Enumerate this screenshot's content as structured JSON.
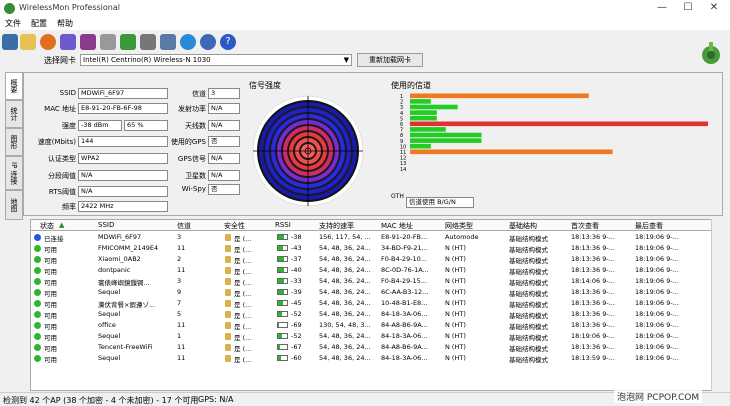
{
  "window": {
    "title": "WirelessMon Professional"
  },
  "menu": [
    "文件",
    "配置",
    "帮助"
  ],
  "adapter": {
    "label": "选择网卡",
    "value": "Intel(R) Centrino(R) Wireless-N 1030",
    "reload_label": "重新加载网卡"
  },
  "side_tabs": [
    "概要",
    "统计",
    "图形",
    "IP 连接",
    "地图"
  ],
  "info": {
    "ssid_label": "SSID",
    "ssid": "MDWiFi_6F97",
    "mac_label": "MAC 地址",
    "mac": "E8-91-20-FB-6F-98",
    "strength_label": "强度",
    "strength_dbm": "-38 dBm",
    "strength_pct": "65 %",
    "speed_label": "速度(Mbits)",
    "speed": "144",
    "auth_label": "认证类型",
    "auth": "WPA2",
    "frag_label": "分段阈值",
    "frag": "N/A",
    "rts_label": "RTS阈值",
    "rts": "N/A",
    "freq_label": "频率",
    "freq": "2422 MHz",
    "channel_label": "信道",
    "channel": "3",
    "txpower_label": "发射功率",
    "txpower": "N/A",
    "antenna_label": "天线数",
    "antenna": "N/A",
    "gps_used_label": "使用的GPS",
    "gps_used": "否",
    "gps_signal_label": "GPS信号",
    "gps_signal": "N/A",
    "satellites_label": "卫星数",
    "satellites": "N/A",
    "wispy_label": "Wi-Spy",
    "wispy": "否"
  },
  "signal": {
    "title": "信号强度"
  },
  "channels": {
    "title": "使用的信道",
    "labels": [
      "1",
      "2",
      "3",
      "4",
      "5",
      "6",
      "7",
      "8",
      "9",
      "10",
      "11",
      "12",
      "13",
      "14"
    ],
    "other_label": "OTH",
    "bars": [
      {
        "channel": "1",
        "level": 0.6,
        "color": "#f07820"
      },
      {
        "channel": "2",
        "level": 0.07,
        "color": "#22cc22"
      },
      {
        "channel": "3",
        "level": 0.16,
        "color": "#22cc22"
      },
      {
        "channel": "4",
        "level": 0.09,
        "color": "#22cc22"
      },
      {
        "channel": "5",
        "level": 0.09,
        "color": "#22cc22"
      },
      {
        "channel": "6",
        "level": 1.0,
        "color": "#e03030"
      },
      {
        "channel": "7",
        "level": 0.12,
        "color": "#22cc22"
      },
      {
        "channel": "8",
        "level": 0.24,
        "color": "#22cc22"
      },
      {
        "channel": "9",
        "level": 0.24,
        "color": "#22cc22"
      },
      {
        "channel": "10",
        "level": 0.07,
        "color": "#22cc22"
      },
      {
        "channel": "11",
        "level": 0.68,
        "color": "#f07820"
      }
    ],
    "select_value": "信道使用 B/G/N"
  },
  "table": {
    "headers": [
      "状态",
      "SSID",
      "信道",
      "安全性",
      "RSSI",
      "支持的速率",
      "MAC 地址",
      "网络类型",
      "基础结构",
      "首次查看",
      "最后查看"
    ],
    "rows": [
      {
        "status": "已连接",
        "status_color": "#2255dd",
        "ssid": "MDWiFi_6F97",
        "channel": "3",
        "security": "是 (...",
        "rssi": "-38",
        "rssi_level": 0.65,
        "rates": "156, 117, 54, ...",
        "mac": "E8-91-20-FB...",
        "nettype": "Automode",
        "infra": "基础结构模式",
        "first": "18:13:36 9-...",
        "last": "18:19:06 9-..."
      },
      {
        "status": "可用",
        "status_color": "#2db52d",
        "ssid": "FMICOMM_2149E4",
        "channel": "11",
        "security": "是 (...",
        "rssi": "-43",
        "rssi_level": 0.57,
        "rates": "54, 48, 36, 24...",
        "mac": "34-BD-F9-21...",
        "nettype": "N (HT)",
        "infra": "基础结构模式",
        "first": "18:13:36 9-...",
        "last": "18:19:06 9-..."
      },
      {
        "status": "可用",
        "status_color": "#2db52d",
        "ssid": "Xiaomi_0AB2",
        "channel": "2",
        "security": "是 (...",
        "rssi": "-37",
        "rssi_level": 0.67,
        "rates": "54, 48, 36, 24...",
        "mac": "F0-B4-29-10...",
        "nettype": "N (HT)",
        "infra": "基础结构模式",
        "first": "18:13:36 9-...",
        "last": "18:19:06 9-..."
      },
      {
        "status": "可用",
        "status_color": "#2db52d",
        "ssid": "dontpanic",
        "channel": "11",
        "security": "是 (...",
        "rssi": "-40",
        "rssi_level": 0.62,
        "rates": "54, 48, 36, 24...",
        "mac": "8C-0D-76-1A...",
        "nettype": "N (HT)",
        "infra": "基础结构模式",
        "first": "18:13:36 9-...",
        "last": "18:19:06 9-..."
      },
      {
        "status": "可用",
        "status_color": "#2db52d",
        "ssid": "寰俵峰嶼鏡鏁锕...",
        "channel": "3",
        "security": "是 (...",
        "rssi": "-33",
        "rssi_level": 0.72,
        "rates": "54, 48, 36, 24...",
        "mac": "F0-B4-29-15...",
        "nettype": "N (HT)",
        "infra": "基础结构模式",
        "first": "18:14:06 9-...",
        "last": "18:19:06 9-..."
      },
      {
        "status": "可用",
        "status_color": "#2db52d",
        "ssid": "Sequel",
        "channel": "9",
        "security": "是 (...",
        "rssi": "-39",
        "rssi_level": 0.63,
        "rates": "54, 48, 36, 24...",
        "mac": "6C-AA-B3-12...",
        "nettype": "N (HT)",
        "infra": "基础结构模式",
        "first": "18:13:36 9-...",
        "last": "18:19:06 9-..."
      },
      {
        "status": "可用",
        "status_color": "#2db52d",
        "ssid": "瀵伏背餐×鍜遵ゾ...",
        "channel": "7",
        "security": "是 (...",
        "rssi": "-45",
        "rssi_level": 0.53,
        "rates": "54, 48, 36, 24...",
        "mac": "10-48-B1-E8...",
        "nettype": "N (HT)",
        "infra": "基础结构模式",
        "first": "18:13:36 9-...",
        "last": "18:19:06 9-..."
      },
      {
        "status": "可用",
        "status_color": "#2db52d",
        "ssid": "Sequel",
        "channel": "5",
        "security": "是 (...",
        "rssi": "-52",
        "rssi_level": 0.42,
        "rates": "54, 48, 36, 24...",
        "mac": "84-18-3A-06...",
        "nettype": "N (HT)",
        "infra": "基础结构模式",
        "first": "18:13:36 9-...",
        "last": "18:19:06 9-..."
      },
      {
        "status": "可用",
        "status_color": "#2db52d",
        "ssid": "office",
        "channel": "11",
        "security": "是 (...",
        "rssi": "-69",
        "rssi_level": 0.15,
        "rates": "130, 54, 48, 3...",
        "mac": "84-A8-B6-9A...",
        "nettype": "N (HT)",
        "infra": "基础结构模式",
        "first": "18:13:36 9-...",
        "last": "18:19:06 9-..."
      },
      {
        "status": "可用",
        "status_color": "#2db52d",
        "ssid": "Sequel",
        "channel": "1",
        "security": "是 (...",
        "rssi": "-52",
        "rssi_level": 0.42,
        "rates": "54, 48, 36, 24...",
        "mac": "84-18-3A-06...",
        "nettype": "N (HT)",
        "infra": "基础结构模式",
        "first": "18:19:06 9-...",
        "last": "18:19:06 9-..."
      },
      {
        "status": "可用",
        "status_color": "#2db52d",
        "ssid": "Tencent-FreeWiFi",
        "channel": "11",
        "security": "是 (...",
        "rssi": "-67",
        "rssi_level": 0.18,
        "rates": "54, 48, 36, 24...",
        "mac": "84-A8-B6-9A...",
        "nettype": "N (HT)",
        "infra": "基础结构模式",
        "first": "18:13:36 9-...",
        "last": "18:19:06 9-..."
      },
      {
        "status": "可用",
        "status_color": "#2db52d",
        "ssid": "Sequel",
        "channel": "11",
        "security": "是 (...",
        "rssi": "-60",
        "rssi_level": 0.28,
        "rates": "54, 48, 36, 24...",
        "mac": "84-18-3A-06...",
        "nettype": "N (HT)",
        "infra": "基础结构模式",
        "first": "18:13:59 9-...",
        "last": "18:19:06 9-..."
      }
    ]
  },
  "status": {
    "left": "检测到 42 个AP (38 个加密 - 4 个未加密) - 17 个可用",
    "gps": "GPS: N/A"
  },
  "watermark": "泡泡网 PCPOP.COM"
}
